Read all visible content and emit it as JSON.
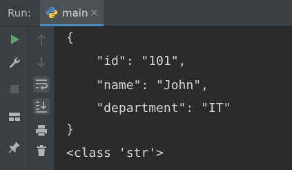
{
  "run_panel": {
    "label": "Run:",
    "tab": {
      "label": "main",
      "close": "×",
      "icon": "python-icon"
    }
  },
  "toolbar_left": [
    {
      "name": "run-icon",
      "color": "#59a869"
    },
    {
      "name": "wrench-icon"
    },
    {
      "name": "stop-icon"
    },
    {
      "name": "layout-icon"
    },
    {
      "name": "pin-icon"
    }
  ],
  "toolbar_right": [
    {
      "name": "arrow-up-icon"
    },
    {
      "name": "arrow-down-icon"
    },
    {
      "name": "soft-wrap-icon"
    },
    {
      "name": "scroll-to-end-icon"
    },
    {
      "name": "print-icon"
    },
    {
      "name": "trash-icon"
    }
  ],
  "console": {
    "lines": [
      "{",
      "    \"id\": \"101\",",
      "    \"name\": \"John\",",
      "    \"department\": \"IT\"",
      "}",
      "<class 'str'>"
    ]
  }
}
